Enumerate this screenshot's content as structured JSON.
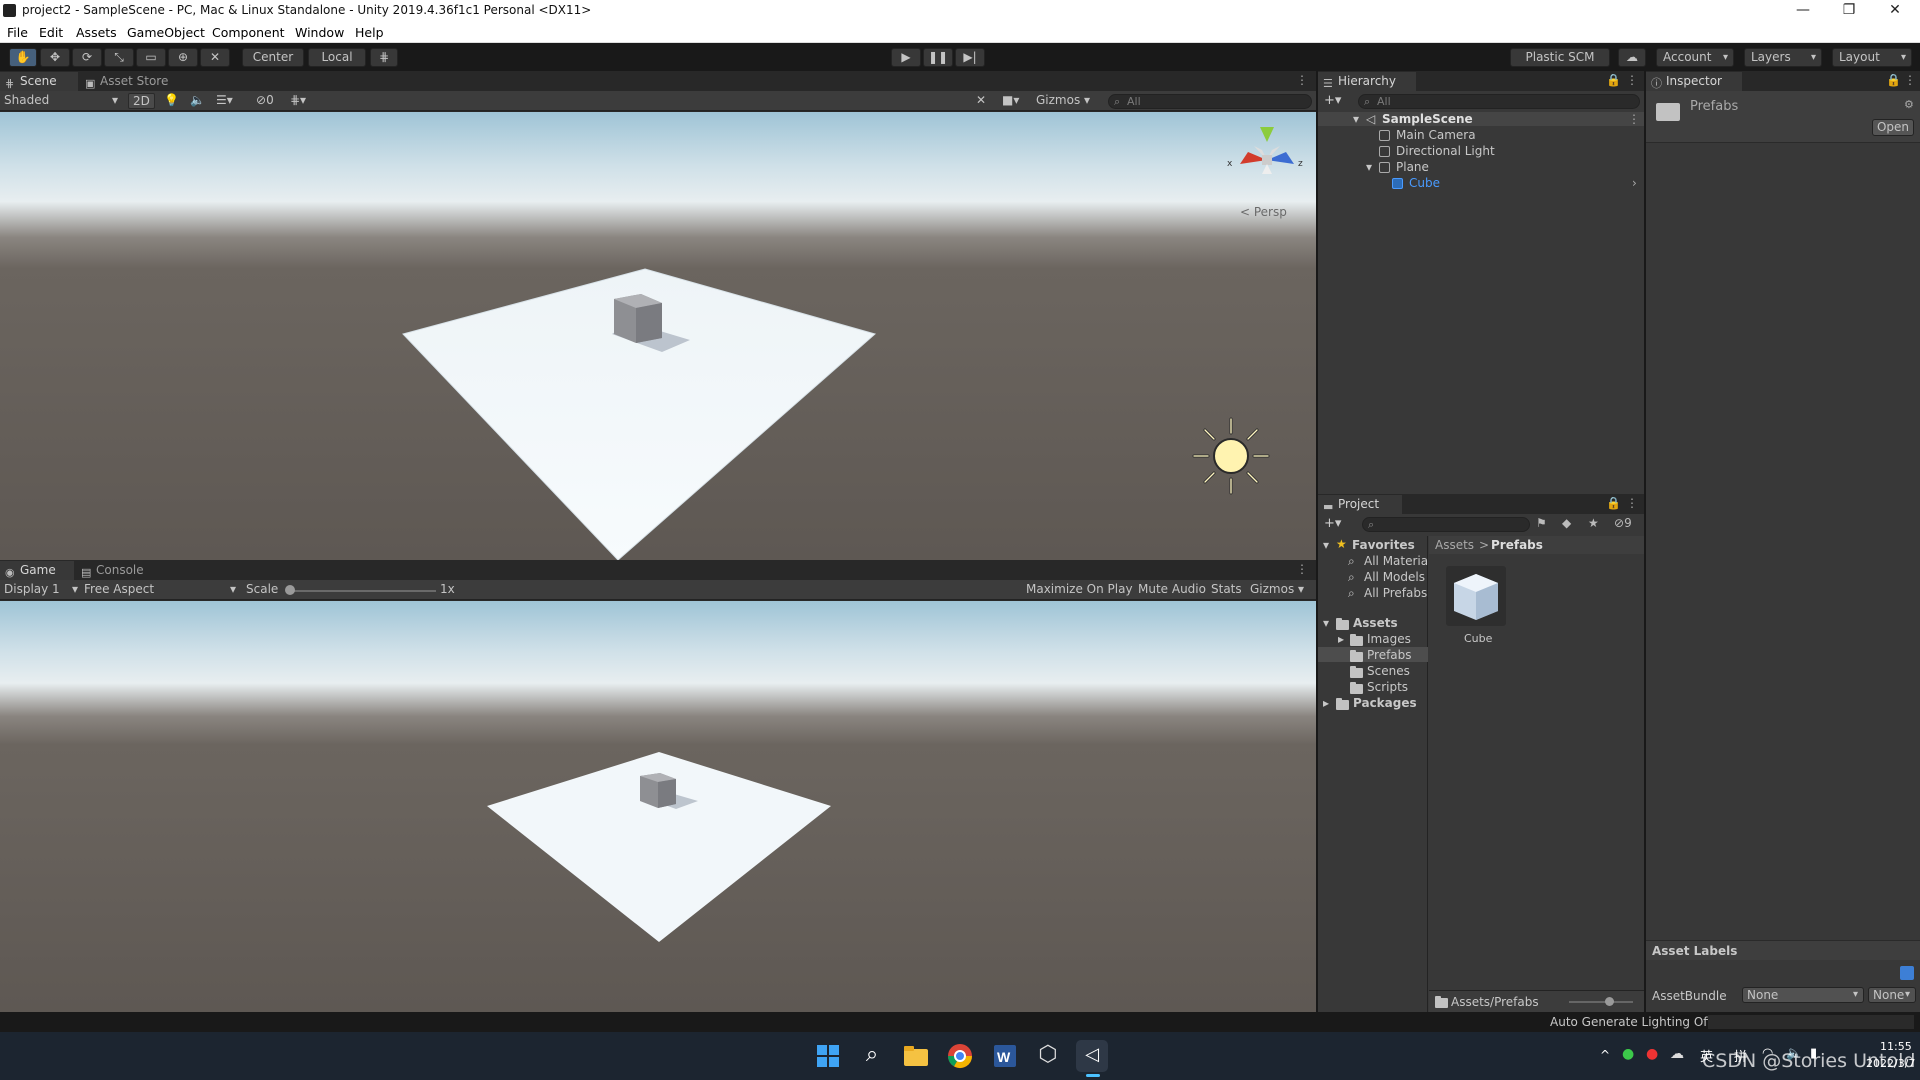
{
  "window": {
    "title": "project2 - SampleScene - PC, Mac & Linux Standalone - Unity 2019.4.36f1c1 Personal <DX11>",
    "controls": [
      "—",
      "❐",
      "✕"
    ]
  },
  "menu": [
    "File",
    "Edit",
    "Assets",
    "GameObject",
    "Component",
    "Window",
    "Help"
  ],
  "toolbar": {
    "pivot_label": "Center",
    "space_label": "Local",
    "plastic_label": "Plastic SCM",
    "account_label": "Account",
    "layers_label": "Layers",
    "layout_label": "Layout"
  },
  "scene": {
    "tabs": [
      "Scene",
      "Asset Store"
    ],
    "shading": "Shaded",
    "mode_2d": "2D",
    "hidden_count": "0",
    "gizmos_label": "Gizmos",
    "search_placeholder": "All",
    "persp_label": "< Persp",
    "axis_x": "x",
    "axis_z": "z"
  },
  "game": {
    "tabs": [
      "Game",
      "Console"
    ],
    "display": "Display 1",
    "aspect": "Free Aspect",
    "scale_label": "Scale",
    "scale_value": "1x",
    "maximize": "Maximize On Play",
    "mute": "Mute Audio",
    "stats": "Stats",
    "gizmos": "Gizmos"
  },
  "hierarchy": {
    "tab": "Hierarchy",
    "search_placeholder": "All",
    "scene_name": "SampleScene",
    "items": [
      "Main Camera",
      "Directional Light",
      "Plane",
      "Cube"
    ]
  },
  "project": {
    "tab": "Project",
    "hidden_count": "9",
    "favorites_label": "Favorites",
    "favorites": [
      "All Materia",
      "All Models",
      "All Prefabs"
    ],
    "assets_label": "Assets",
    "folders": [
      "Images",
      "Prefabs",
      "Scenes",
      "Scripts"
    ],
    "packages_label": "Packages",
    "breadcrumb_root": "Assets",
    "breadcrumb_sep": ">",
    "breadcrumb_current": "Prefabs",
    "asset_name": "Cube",
    "footer_path": "Assets/Prefabs"
  },
  "inspector": {
    "tab": "Inspector",
    "object_name": "Prefabs",
    "open_button": "Open",
    "asset_labels": "Asset Labels",
    "assetbundle_label": "AssetBundle",
    "assetbundle_value": "None",
    "variant_value": "None"
  },
  "status": {
    "lighting": "Auto Generate Lighting Off"
  },
  "taskbar": {
    "time": "11:55",
    "date": "2022/3/7",
    "ime": "英",
    "ime2": "拼",
    "watermark": "CSDN @Stories Untold"
  },
  "colors": {
    "selection": "#4a9bff",
    "panel": "#383838",
    "toolbar": "#191919"
  }
}
